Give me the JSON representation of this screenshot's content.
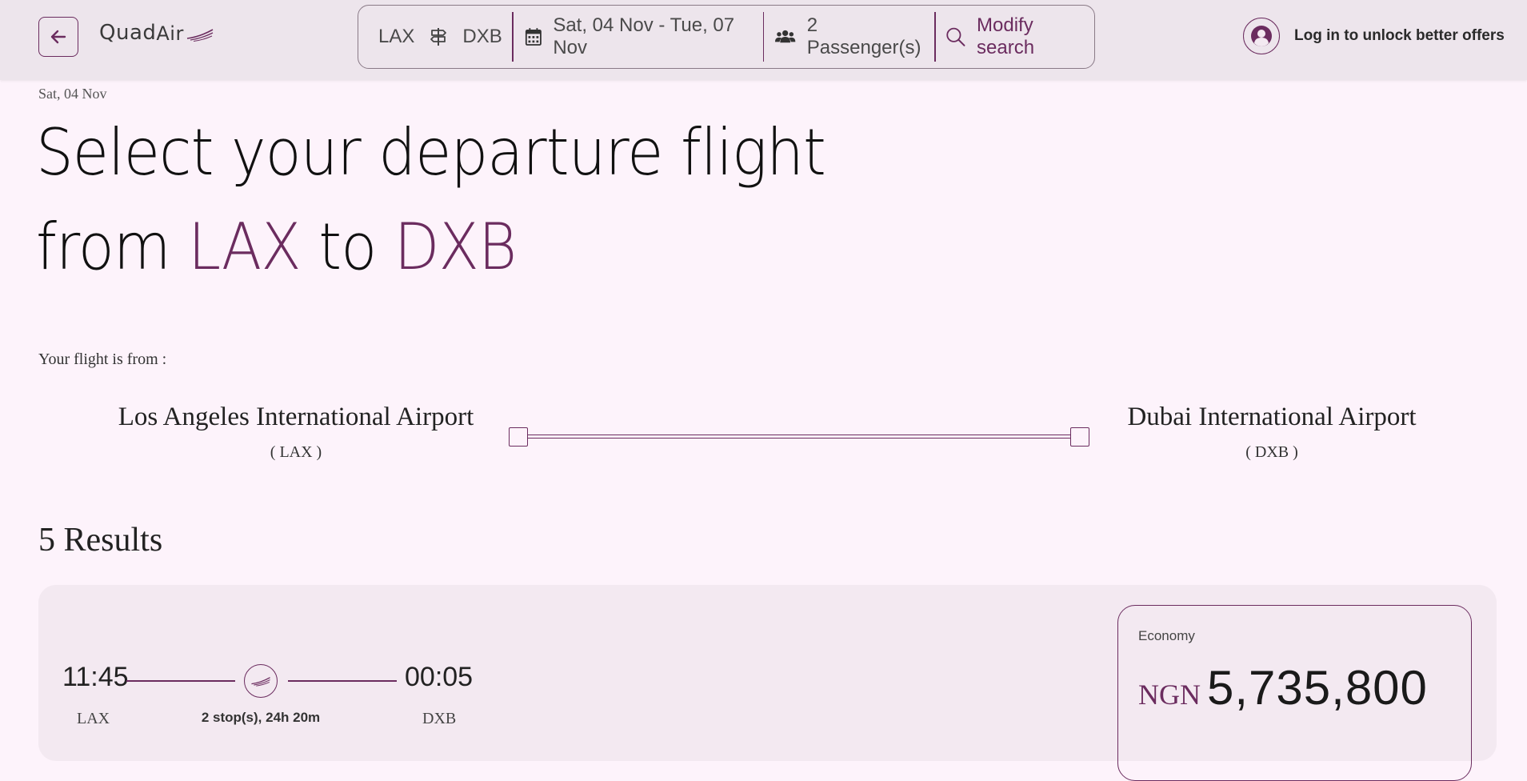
{
  "header": {
    "logo": {
      "quad": "Quad",
      "air": "Air"
    },
    "search": {
      "origin": "LAX",
      "destination": "DXB",
      "dates": "Sat, 04 Nov - Tue, 07 Nov",
      "passengers": "2 Passenger(s)",
      "modify_label": "Modify search"
    },
    "login_label": "Log in to unlock better offers"
  },
  "page": {
    "date": "Sat, 04 Nov",
    "title_line1": "Select your departure flight",
    "title_from": "from",
    "title_origin": "LAX",
    "title_to": "to",
    "title_destination": "DXB",
    "flight_from_label": "Your flight is from :"
  },
  "route": {
    "origin_name": "Los Angeles International Airport",
    "origin_code": "( LAX )",
    "destination_name": "Dubai International Airport",
    "destination_code": "( DXB )"
  },
  "results": {
    "count_label": "5 Results",
    "items": [
      {
        "departure_time": "11:45",
        "departure_code": "LAX",
        "arrival_time": "00:05",
        "arrival_code": "DXB",
        "stops": "2 stop(s), 24h 20m",
        "fare_class": "Economy",
        "currency": "NGN",
        "price": "5,735,800"
      }
    ]
  },
  "colors": {
    "accent": "#6b2c5f",
    "background": "#fdf3fb",
    "header_bg": "#ede5ec",
    "card_bg": "#f3e9f1"
  },
  "icons": {
    "back": "arrow-left-icon",
    "route": "signpost-icon",
    "calendar": "calendar-icon",
    "passengers": "users-icon",
    "search": "search-icon",
    "avatar": "user-icon",
    "plane": "airline-swoosh-icon"
  }
}
